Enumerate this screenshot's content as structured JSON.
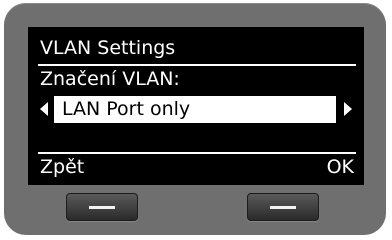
{
  "screen": {
    "title": "VLAN Settings",
    "field_label": "Značení VLAN:",
    "selected_value": "LAN Port only"
  },
  "softkeys": {
    "left_label": "Zpět",
    "right_label": "OK"
  },
  "colors": {
    "screen_bg": "#000000",
    "text": "#ffffff",
    "bezel": "#6f6f6f"
  },
  "icons": {
    "left_arrow": "triangle-left",
    "right_arrow": "triangle-right",
    "hardware_button": "minus-bar"
  }
}
